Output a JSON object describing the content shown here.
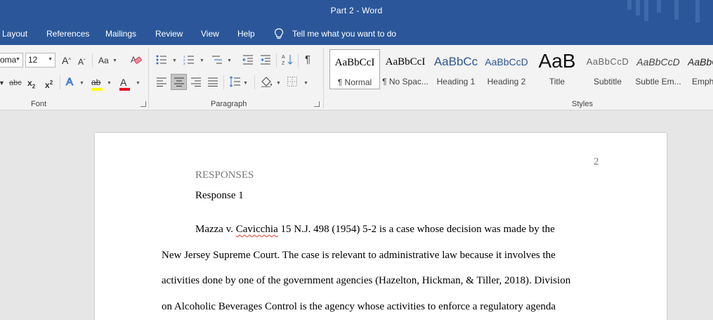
{
  "window": {
    "title": "Part 2  -  Word"
  },
  "tabs": [
    "Layout",
    "References",
    "Mailings",
    "Review",
    "View",
    "Help"
  ],
  "tell_me": {
    "placeholder": "Tell me what you want to do",
    "icon": "lightbulb-icon"
  },
  "font_group": {
    "label": "Font",
    "font_name": "oma",
    "font_size": "12",
    "change_case": "Aa",
    "grow_font": "A",
    "shrink_font": "A",
    "strikethrough": "abc",
    "subscript": "x",
    "subscript_mark": "2",
    "superscript": "x",
    "superscript_mark": "2",
    "text_effects": "A",
    "highlight": "ab",
    "font_color": "A",
    "highlight_color": "#ffff00",
    "font_color_value": "#e81123"
  },
  "paragraph_group": {
    "label": "Paragraph",
    "show_marks": "¶"
  },
  "styles_group": {
    "label": "Styles",
    "items": [
      {
        "preview": "AaBbCcI",
        "name": "¶ Normal"
      },
      {
        "preview": "AaBbCcI",
        "name": "¶ No Spac..."
      },
      {
        "preview": "AaBbCc",
        "name": "Heading 1"
      },
      {
        "preview": "AaBbCcD",
        "name": "Heading 2"
      },
      {
        "preview": "AaB",
        "name": "Title"
      },
      {
        "preview": "AaBbCcD",
        "name": "Subtitle"
      },
      {
        "preview": "AaBbCcD",
        "name": "Subtle Em..."
      },
      {
        "preview": "AaBbC",
        "name": "Emph"
      }
    ]
  },
  "document": {
    "page_number": "2",
    "heading": "RESPONSES",
    "subheading": "Response 1",
    "para": {
      "l1_a": "Mazza v. ",
      "l1_b": "Cavicchia",
      "l1_c": " 15 N.J. 498 (1954) 5-2 is a case whose decision was made by the",
      "l2": "New Jersey Supreme Court. The case is relevant to administrative law because it involves the",
      "l3": "activities done by one of the government agencies (Hazelton, Hickman, & Tiller, 2018). Division",
      "l4": "on Alcoholic Beverages Control is the agency whose activities to enforce a regulatory agenda"
    }
  }
}
